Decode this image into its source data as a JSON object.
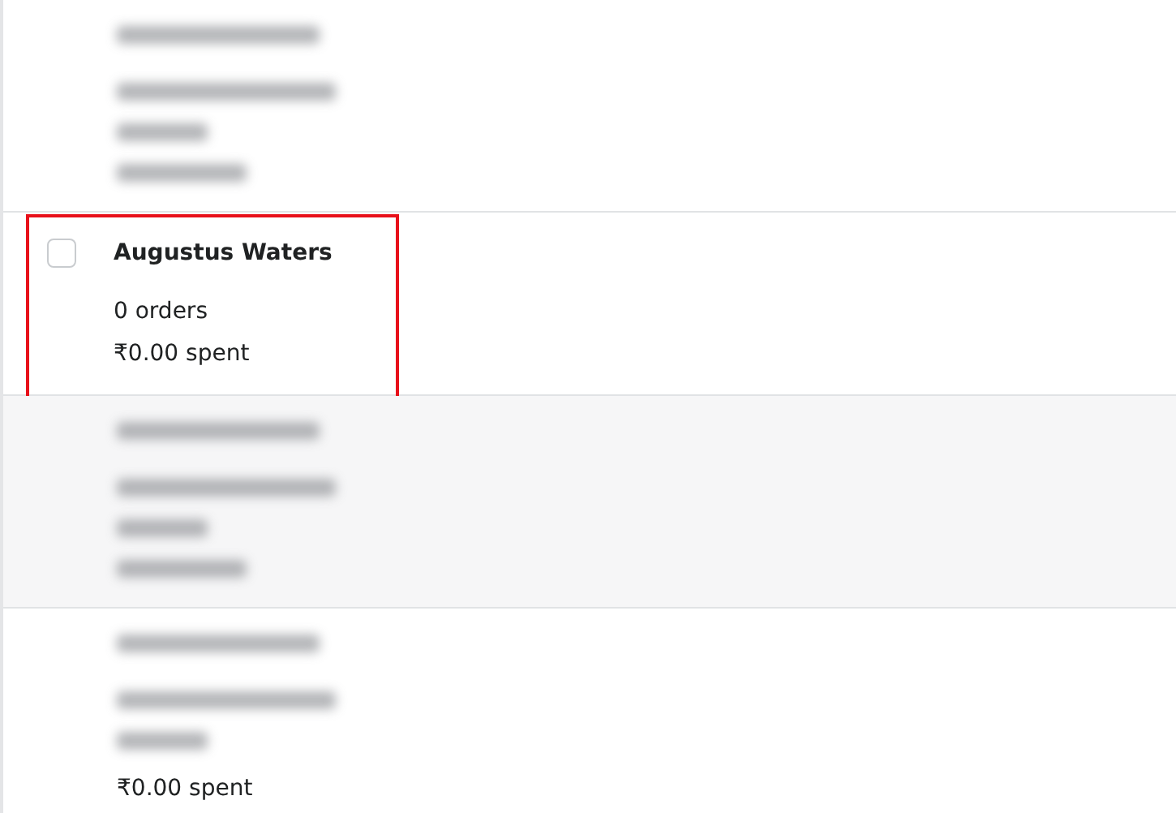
{
  "customers": [
    {
      "kind": "blurred"
    },
    {
      "kind": "plain",
      "checked": false,
      "highlighted": true,
      "name": "Augustus Waters",
      "orders": "0 orders",
      "spent": "₹0.00 spent"
    },
    {
      "kind": "blurred_shaded"
    },
    {
      "kind": "blurred",
      "spent": "₹0.00 spent"
    }
  ]
}
